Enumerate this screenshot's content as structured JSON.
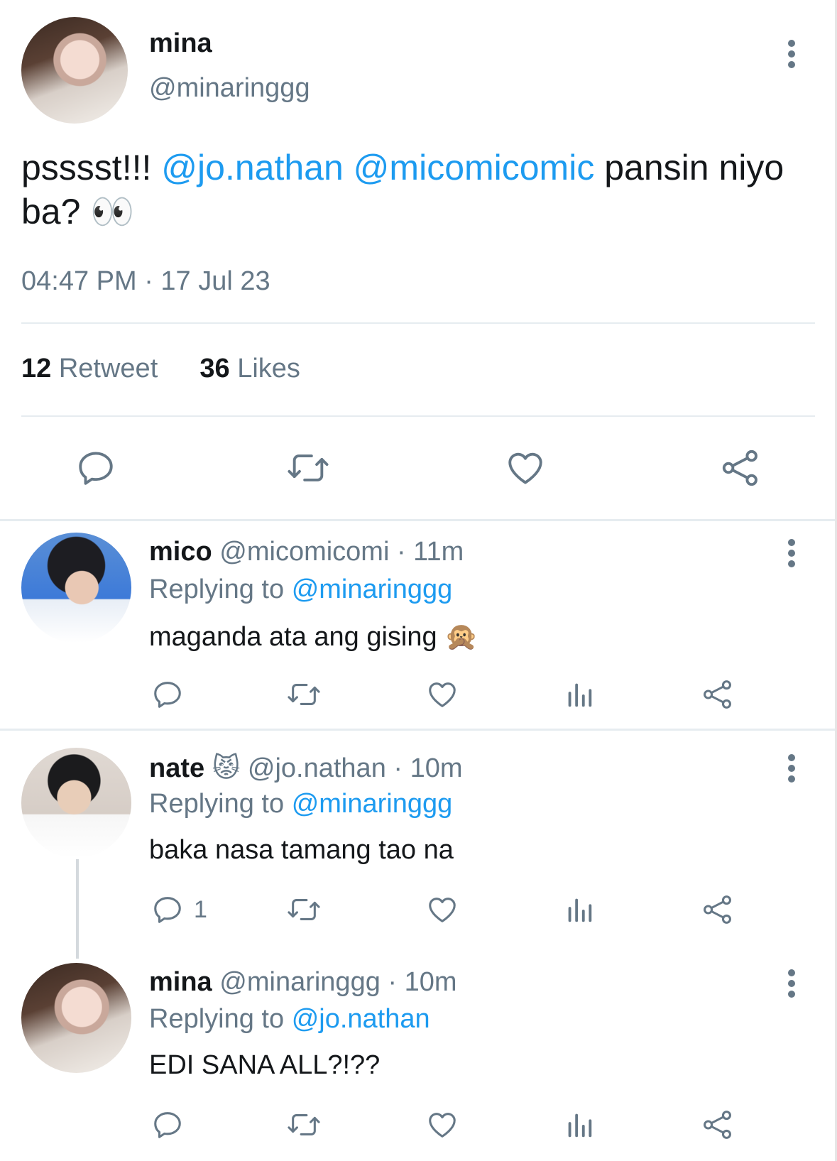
{
  "main_tweet": {
    "name": "mina",
    "handle": "@minaringgg",
    "text_parts": [
      "psssst!!! ",
      "@jo.nathan",
      " ",
      "@micomicomic",
      " pansin niyo ba? ",
      "👀"
    ],
    "timestamp": "04:47 PM · 17 Jul 23",
    "retweet_count": "12",
    "retweet_label": "Retweet",
    "likes_count": "36",
    "likes_label": "Likes"
  },
  "replies": [
    {
      "name": "mico",
      "handle": "@micomicomi",
      "time": "· 11m",
      "replying_label": "Replying to",
      "replying_handle": "@minaringgg",
      "text": "maganda ata ang gising 🙊",
      "reply_count": ""
    },
    {
      "name": "nate",
      "name_emoji": "😾",
      "handle": "@jo.nathan",
      "time": "· 10m",
      "replying_label": "Replying to",
      "replying_handle": "@minaringgg",
      "text": "baka nasa tamang tao na",
      "reply_count": "1"
    },
    {
      "name": "mina",
      "handle": "@minaringgg",
      "time": "· 10m",
      "replying_label": "Replying to",
      "replying_handle": "@jo.nathan",
      "text": "EDI SANA ALL?!??",
      "reply_count": ""
    }
  ],
  "icons": [
    "more-icon",
    "reply-icon",
    "retweet-icon",
    "like-icon",
    "views-icon",
    "share-icon"
  ],
  "colors": {
    "link": "#1d9bf0",
    "muted": "#657786",
    "text": "#14171a",
    "divider": "#e6ecf0"
  }
}
